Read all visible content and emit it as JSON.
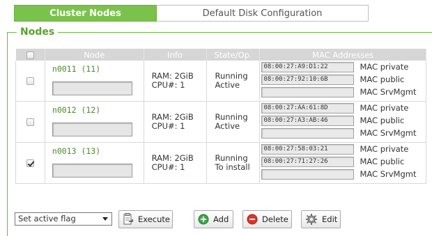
{
  "tabs": [
    {
      "label": "Cluster Nodes",
      "active": true
    },
    {
      "label": "Default Disk Configuration",
      "active": false
    }
  ],
  "section": {
    "legend": "Nodes"
  },
  "table": {
    "headers": {
      "node": "Node",
      "info": "Info",
      "state": "State/Op.",
      "mac": "MAC Addresses"
    },
    "rows": [
      {
        "checked": false,
        "node": "n0011 (11)",
        "ram": "RAM: 2GiB",
        "cpu": "CPU#: 1",
        "state": "Running",
        "op": "Active",
        "macs": [
          "08:00:27:A9:D1:22",
          "08:00:27:92:10:6B",
          ""
        ],
        "mac_labels": [
          "MAC private",
          "MAC public",
          "MAC SrvMgmt"
        ]
      },
      {
        "checked": false,
        "node": "n0012 (12)",
        "ram": "RAM: 2GiB",
        "cpu": "CPU#: 1",
        "state": "Running",
        "op": "Active",
        "macs": [
          "08:00:27:AA:61:8D",
          "08:00:27:A3:AB:46",
          ""
        ],
        "mac_labels": [
          "MAC private",
          "MAC public",
          "MAC SrvMgmt"
        ]
      },
      {
        "checked": true,
        "node": "n0013 (13)",
        "ram": "RAM: 2GiB",
        "cpu": "CPU#: 1",
        "state": "Running",
        "op": "To install",
        "macs": [
          "08:00:27:58:03:21",
          "08:00:27:71:27:26",
          ""
        ],
        "mac_labels": [
          "MAC private",
          "MAC public",
          "MAC SrvMgmt"
        ]
      }
    ]
  },
  "toolbar": {
    "select_value": "Set active flag",
    "execute_label": "Execute",
    "add_label": "Add",
    "delete_label": "Delete",
    "edit_label": "Edit"
  },
  "icons": {
    "execute": "clipboard-run-icon",
    "add": "add-icon",
    "delete": "delete-icon",
    "edit": "gear-icon"
  },
  "colors": {
    "accent": "#7bc24d",
    "legend": "#5aa12f",
    "node_text": "#4a8a2a"
  }
}
